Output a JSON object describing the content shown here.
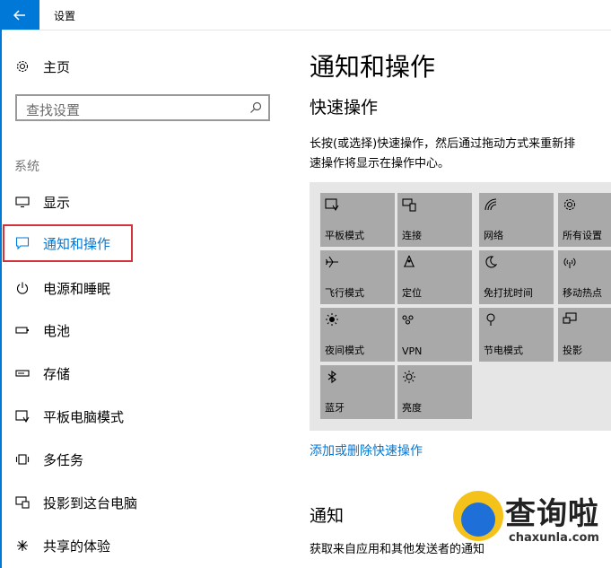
{
  "window": {
    "title": "设置"
  },
  "sidebar": {
    "home_label": "主页",
    "search_placeholder": "查找设置",
    "section_label": "系统",
    "items": [
      {
        "label": "显示",
        "icon": "monitor-icon"
      },
      {
        "label": "通知和操作",
        "icon": "notification-icon",
        "active": true
      },
      {
        "label": "电源和睡眠",
        "icon": "power-icon"
      },
      {
        "label": "电池",
        "icon": "battery-icon"
      },
      {
        "label": "存储",
        "icon": "storage-icon"
      },
      {
        "label": "平板电脑模式",
        "icon": "tablet-mode-icon"
      },
      {
        "label": "多任务",
        "icon": "multitasking-icon"
      },
      {
        "label": "投影到这台电脑",
        "icon": "project-icon"
      },
      {
        "label": "共享的体验",
        "icon": "shared-experience-icon"
      }
    ]
  },
  "main": {
    "title": "通知和操作",
    "quick_actions_title": "快速操作",
    "description_line1": "长按(或选择)快速操作，然后通过拖动方式来重新排",
    "description_line2": "速操作将显示在操作中心。",
    "tiles": [
      {
        "label": "平板模式",
        "icon": "tablet-icon"
      },
      {
        "label": "连接",
        "icon": "connect-icon"
      },
      {
        "label": "网络",
        "icon": "network-icon"
      },
      {
        "label": "所有设置",
        "icon": "gear-icon"
      },
      {
        "label": "飞行模式",
        "icon": "airplane-icon"
      },
      {
        "label": "定位",
        "icon": "location-icon"
      },
      {
        "label": "免打扰时间",
        "icon": "moon-icon"
      },
      {
        "label": "移动热点",
        "icon": "hotspot-icon"
      },
      {
        "label": "夜间模式",
        "icon": "night-light-icon"
      },
      {
        "label": "VPN",
        "icon": "vpn-icon"
      },
      {
        "label": "节电模式",
        "icon": "battery-saver-icon"
      },
      {
        "label": "投影",
        "icon": "project-tile-icon"
      },
      {
        "label": "蓝牙",
        "icon": "bluetooth-icon"
      },
      {
        "label": "亮度",
        "icon": "brightness-icon"
      }
    ],
    "add_remove_link": "添加或删除快速操作",
    "notifications_title": "通知",
    "notifications_desc": "获取来自应用和其他发送者的通知"
  },
  "watermark": {
    "text": "查询啦",
    "domain": "chaxunla.com"
  },
  "colors": {
    "accent": "#0078d7",
    "tile": "#a9a9a9",
    "highlight": "#d0343a"
  }
}
